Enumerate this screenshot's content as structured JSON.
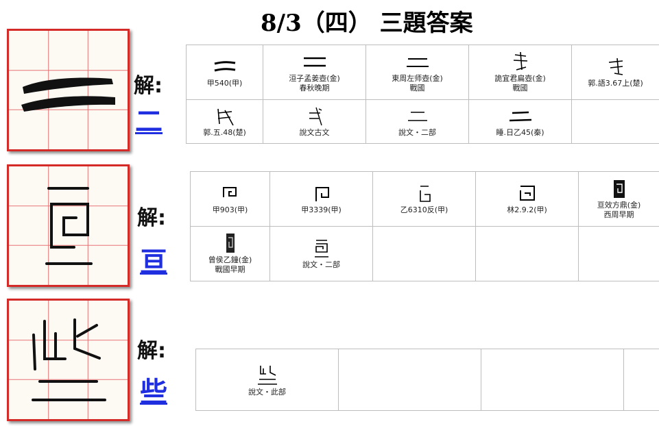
{
  "title": "8/3（四） 三題答案",
  "answer_prefix": "解:",
  "sections": [
    {
      "answer": "二",
      "cells": [
        {
          "glyph": "二",
          "caption1": "甲540(甲)",
          "caption2": ""
        },
        {
          "glyph": "二",
          "caption1": "洹子孟姜壺(金)",
          "caption2": "春秋晚期"
        },
        {
          "glyph": "二",
          "caption1": "東周左师壺(金)",
          "caption2": "戰國"
        },
        {
          "glyph": "弍",
          "caption1": "詭宜君扁壺(金)",
          "caption2": "戰國"
        },
        {
          "glyph": "弍",
          "caption1": "郭.語3.67上(楚)",
          "caption2": ""
        },
        {
          "glyph": "弍",
          "caption1": "郭.五.48(楚)",
          "caption2": ""
        },
        {
          "glyph": "弍",
          "caption1": "說文古文",
          "caption2": ""
        },
        {
          "glyph": "二",
          "caption1": "說文・二部",
          "caption2": ""
        },
        {
          "glyph": "二",
          "caption1": "睡.日乙45(秦)",
          "caption2": ""
        },
        {
          "glyph": "",
          "caption1": "",
          "caption2": ""
        }
      ]
    },
    {
      "answer": "亘",
      "cells": [
        {
          "glyph": "亘",
          "caption1": "甲903(甲)",
          "caption2": ""
        },
        {
          "glyph": "亘",
          "caption1": "甲3339(甲)",
          "caption2": ""
        },
        {
          "glyph": "亘",
          "caption1": "乙6310反(甲)",
          "caption2": ""
        },
        {
          "glyph": "亘",
          "caption1": "林2.9.2(甲)",
          "caption2": ""
        },
        {
          "glyph": "亘",
          "caption1": "亘效方鼎(金)",
          "caption2": "西周早期"
        },
        {
          "glyph": "亘",
          "caption1": "曾侯乙鐘(金)",
          "caption2": "戰國早期"
        },
        {
          "glyph": "亘",
          "caption1": "說文・二部",
          "caption2": ""
        },
        {
          "glyph": "",
          "caption1": "",
          "caption2": ""
        },
        {
          "glyph": "",
          "caption1": "",
          "caption2": ""
        },
        {
          "glyph": "",
          "caption1": "",
          "caption2": ""
        }
      ]
    },
    {
      "answer": "些",
      "cells": [
        {
          "glyph": "些",
          "caption1": "說文・此部",
          "caption2": ""
        },
        {
          "glyph": "",
          "caption1": "",
          "caption2": ""
        },
        {
          "glyph": "",
          "caption1": "",
          "caption2": ""
        },
        {
          "glyph": "",
          "caption1": "",
          "caption2": ""
        }
      ]
    }
  ]
}
